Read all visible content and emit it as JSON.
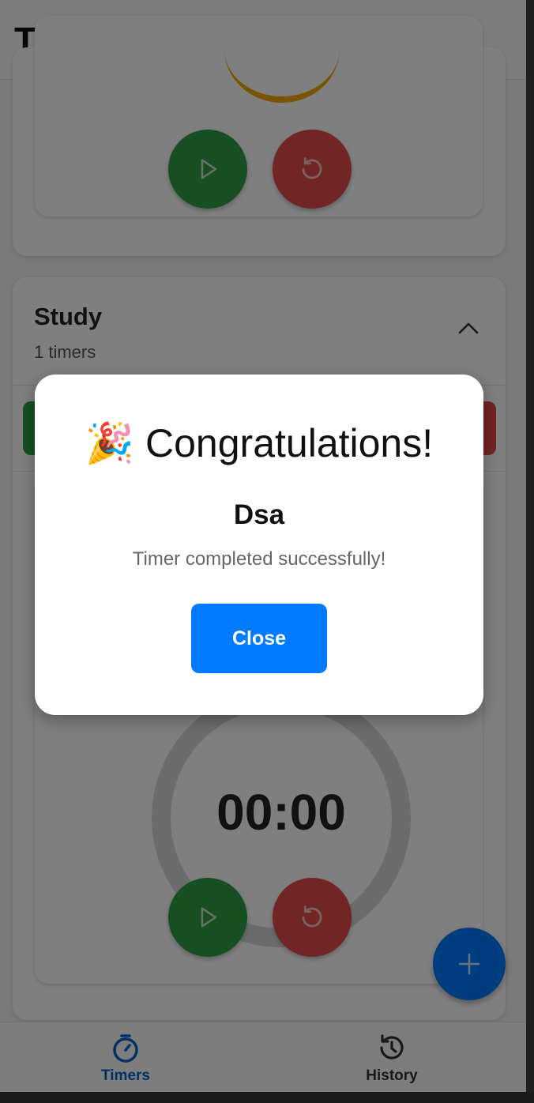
{
  "header": {
    "title": "Timers"
  },
  "group": {
    "title": "Study",
    "subtitle": "1 timers"
  },
  "timer": {
    "display": "00:00"
  },
  "tabs": [
    {
      "label": "Timers",
      "icon": "stopwatch-icon",
      "active": true
    },
    {
      "label": "History",
      "icon": "history-icon",
      "active": false
    }
  ],
  "modal": {
    "emoji": "🎉",
    "title": "Congratulations!",
    "timer_name": "Dsa",
    "message": "Timer completed successfully!",
    "close_label": "Close"
  },
  "colors": {
    "accent": "#007bff",
    "play": "#2e9f47",
    "reset": "#e34a4a",
    "progress": "#f0a800"
  }
}
